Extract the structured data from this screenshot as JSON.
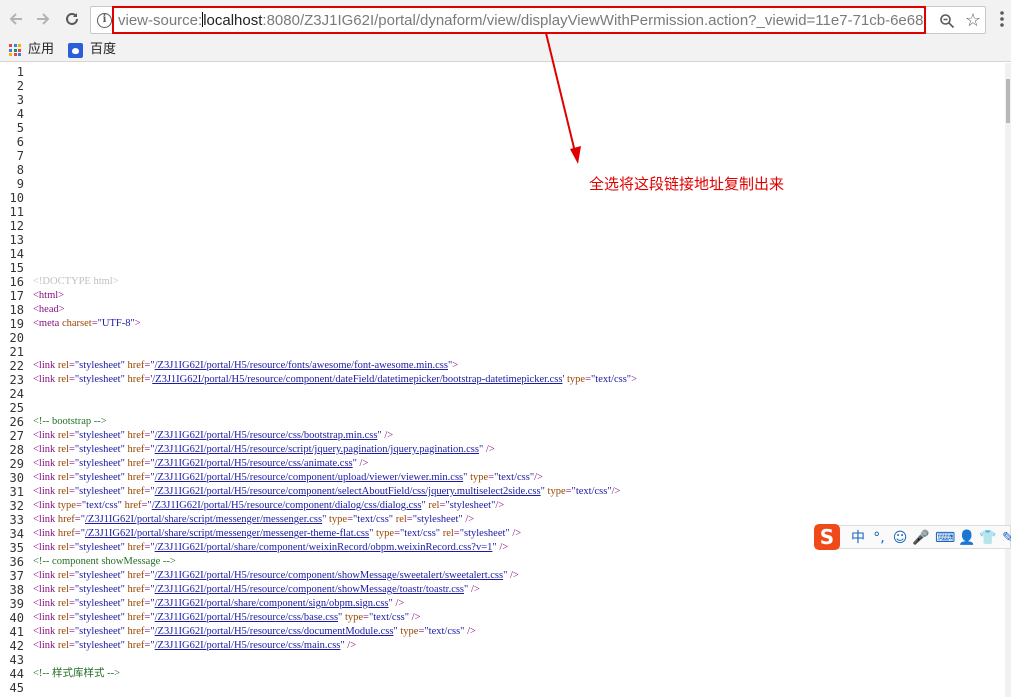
{
  "toolbar": {
    "url_prefix": "view-source:",
    "url_host": "localhost",
    "url_rest": ":8080/Z3J1IG62I/portal/dynaform/view/displayViewWithPermission.action?_viewid=11e7-71cb-6e68"
  },
  "bookmarks": [
    {
      "label": "应用",
      "icon": "apps-grid-icon"
    },
    {
      "label": "百度",
      "icon": "baidu-paw-icon"
    }
  ],
  "annotation": {
    "text": "全选将这段链接地址复制出来",
    "color": "#e00000"
  },
  "source_lines": [
    {
      "n": "1",
      "html": ""
    },
    {
      "n": "2",
      "html": ""
    },
    {
      "n": "3",
      "html": ""
    },
    {
      "n": "4",
      "html": ""
    },
    {
      "n": "5",
      "html": ""
    },
    {
      "n": "6",
      "html": ""
    },
    {
      "n": "7",
      "html": ""
    },
    {
      "n": "8",
      "html": ""
    },
    {
      "n": "9",
      "html": ""
    },
    {
      "n": "10",
      "html": ""
    },
    {
      "n": "11",
      "html": ""
    },
    {
      "n": "12",
      "html": ""
    },
    {
      "n": "13",
      "html": ""
    },
    {
      "n": "14",
      "html": ""
    },
    {
      "n": "15",
      "html": ""
    },
    {
      "n": "16",
      "html": "<span class=\"doc\">&lt;!DOCTYPE html&gt;</span>"
    },
    {
      "n": "17",
      "html": "<span class=\"tag\">&lt;html&gt;</span>"
    },
    {
      "n": "18",
      "html": "<span class=\"tag\">&lt;head&gt;</span>"
    },
    {
      "n": "19",
      "html": "<span class=\"tag\">&lt;meta </span><span class=\"attr\">charset</span><span class=\"tag\">=</span><span class=\"val\">\"UTF-8\"</span><span class=\"tag\">&gt;</span>"
    },
    {
      "n": "20",
      "html": ""
    },
    {
      "n": "21",
      "html": ""
    },
    {
      "n": "22",
      "html": "<span class=\"tag\">&lt;link </span><span class=\"attr\">rel</span><span class=\"tag\">=</span><span class=\"val\">\"stylesheet\"</span> <span class=\"attr\">href</span><span class=\"tag\">=</span><span class=\"val\">\"</span><span class=\"link\">/Z3J1IG62I/portal/H5/resource/fonts/awesome/font-awesome.min.css</span><span class=\"val\">\"</span><span class=\"tag\">&gt;</span>"
    },
    {
      "n": "23",
      "html": "<span class=\"tag\">&lt;link </span><span class=\"attr\">rel</span><span class=\"tag\">=</span><span class=\"val\">\"stylesheet\"</span> <span class=\"attr\">href</span><span class=\"tag\">=</span><span class=\"val\">'</span><span class=\"link\">/Z3J1IG62I/portal/H5/resource/component/dateField/datetimepicker/bootstrap-datetimepicker.css</span><span class=\"val\">'</span> <span class=\"attr\">type</span><span class=\"tag\">=</span><span class=\"val\">\"text/css\"</span><span class=\"tag\">&gt;</span>"
    },
    {
      "n": "24",
      "html": ""
    },
    {
      "n": "25",
      "html": ""
    },
    {
      "n": "26",
      "html": "<span class=\"cmt\">&lt;!-- bootstrap --&gt;</span>"
    },
    {
      "n": "27",
      "html": "<span class=\"tag\">&lt;link </span><span class=\"attr\">rel</span><span class=\"tag\">=</span><span class=\"val\">\"stylesheet\"</span> <span class=\"attr\">href</span><span class=\"tag\">=</span><span class=\"val\">\"</span><span class=\"link\">/Z3J1IG62I/portal/H5/resource/css/bootstrap.min.css</span><span class=\"val\">\"</span><span class=\"tag\"> /&gt;</span>"
    },
    {
      "n": "28",
      "html": "<span class=\"tag\">&lt;link </span><span class=\"attr\">rel</span><span class=\"tag\">=</span><span class=\"val\">\"stylesheet\"</span> <span class=\"attr\">href</span><span class=\"tag\">=</span><span class=\"val\">\"</span><span class=\"link\">/Z3J1IG62I/portal/H5/resource/script/jquery.pagination/jquery.pagination.css</span><span class=\"val\">\"</span><span class=\"tag\"> /&gt;</span>"
    },
    {
      "n": "29",
      "html": "<span class=\"tag\">&lt;link </span><span class=\"attr\">rel</span><span class=\"tag\">=</span><span class=\"val\">\"stylesheet\"</span> <span class=\"attr\">href</span><span class=\"tag\">=</span><span class=\"val\">\"</span><span class=\"link\">/Z3J1IG62I/portal/H5/resource/css/animate.css</span><span class=\"val\">\"</span><span class=\"tag\"> /&gt;</span>"
    },
    {
      "n": "30",
      "html": "<span class=\"tag\">&lt;link </span><span class=\"attr\">rel</span><span class=\"tag\">=</span><span class=\"val\">\"stylesheet\"</span> <span class=\"attr\">href</span><span class=\"tag\">=</span><span class=\"val\">\"</span><span class=\"link\">/Z3J1IG62I/portal/H5/resource/component/upload/viewer/viewer.min.css</span><span class=\"val\">\"</span> <span class=\"attr\">type</span><span class=\"tag\">=</span><span class=\"val\">\"text/css\"</span><span class=\"tag\">/&gt;</span>"
    },
    {
      "n": "31",
      "html": "<span class=\"tag\">&lt;link </span><span class=\"attr\">rel</span><span class=\"tag\">=</span><span class=\"val\">\"stylesheet\"</span> <span class=\"attr\">href</span><span class=\"tag\">=</span><span class=\"val\">\"</span><span class=\"link\">/Z3J1IG62I/portal/H5/resource/component/selectAboutField/css/jquery.multiselect2side.css</span><span class=\"val\">\"</span> <span class=\"attr\">type</span><span class=\"tag\">=</span><span class=\"val\">\"text/css\"</span><span class=\"tag\">/&gt;</span>"
    },
    {
      "n": "32",
      "html": "<span class=\"tag\">&lt;link </span><span class=\"attr\">type</span><span class=\"tag\">=</span><span class=\"val\">\"text/css\"</span> <span class=\"attr\">href</span><span class=\"tag\">=</span><span class=\"val\">\"</span><span class=\"link\">/Z3J1IG62I/portal/H5/resource/component/dialog/css/dialog.css</span><span class=\"val\">\"</span> <span class=\"attr\">rel</span><span class=\"tag\">=</span><span class=\"val\">\"stylesheet\"</span><span class=\"tag\">/&gt;</span>"
    },
    {
      "n": "33",
      "html": "<span class=\"tag\">&lt;link </span><span class=\"attr\">href</span><span class=\"tag\">=</span><span class=\"val\">\"</span><span class=\"link\">/Z3J1IG62I/portal/share/script/messenger/messenger.css</span><span class=\"val\">\"</span> <span class=\"attr\">type</span><span class=\"tag\">=</span><span class=\"val\">\"text/css\"</span> <span class=\"attr\">rel</span><span class=\"tag\">=</span><span class=\"val\">\"stylesheet\"</span><span class=\"tag\"> /&gt;</span>"
    },
    {
      "n": "34",
      "html": "<span class=\"tag\">&lt;link </span><span class=\"attr\">href</span><span class=\"tag\">=</span><span class=\"val\">\"</span><span class=\"link\">/Z3J1IG62I/portal/share/script/messenger/messenger-theme-flat.css</span><span class=\"val\">\"</span> <span class=\"attr\">type</span><span class=\"tag\">=</span><span class=\"val\">\"text/css\"</span> <span class=\"attr\">rel</span><span class=\"tag\">=</span><span class=\"val\">\"stylesheet\"</span><span class=\"tag\"> /&gt;</span>"
    },
    {
      "n": "35",
      "html": "<span class=\"tag\">&lt;link </span><span class=\"attr\">rel</span><span class=\"tag\">=</span><span class=\"val\">\"stylesheet\"</span> <span class=\"attr\">href</span><span class=\"tag\">=</span><span class=\"val\">\"</span><span class=\"link\">/Z3J1IG62I/portal/share/component/weixinRecord/obpm.weixinRecord.css?v=1</span><span class=\"val\">\"</span><span class=\"tag\"> /&gt;</span>"
    },
    {
      "n": "36",
      "html": "<span class=\"cmt\">&lt;!-- component showMessage --&gt;</span>"
    },
    {
      "n": "37",
      "html": "<span class=\"tag\">&lt;link </span><span class=\"attr\">rel</span><span class=\"tag\">=</span><span class=\"val\">\"stylesheet\"</span> <span class=\"attr\">href</span><span class=\"tag\">=</span><span class=\"val\">\"</span><span class=\"link\">/Z3J1IG62I/portal/H5/resource/component/showMessage/sweetalert/sweetalert.css</span><span class=\"val\">\"</span><span class=\"tag\"> /&gt;</span>"
    },
    {
      "n": "38",
      "html": "<span class=\"tag\">&lt;link </span><span class=\"attr\">rel</span><span class=\"tag\">=</span><span class=\"val\">\"stylesheet\"</span> <span class=\"attr\">href</span><span class=\"tag\">=</span><span class=\"val\">\"</span><span class=\"link\">/Z3J1IG62I/portal/H5/resource/component/showMessage/toastr/toastr.css</span><span class=\"val\">\"</span><span class=\"tag\"> /&gt;</span>"
    },
    {
      "n": "39",
      "html": "<span class=\"tag\">&lt;link </span><span class=\"attr\">rel</span><span class=\"tag\">=</span><span class=\"val\">\"stylesheet\"</span> <span class=\"attr\">href</span><span class=\"tag\">=</span><span class=\"val\">\"</span><span class=\"link\">/Z3J1IG62I/portal/share/component/sign/obpm.sign.css</span><span class=\"val\">\"</span><span class=\"tag\"> /&gt;</span>"
    },
    {
      "n": "40",
      "html": "<span class=\"tag\">&lt;link </span><span class=\"attr\">rel</span><span class=\"tag\">=</span><span class=\"val\">\"stylesheet\"</span> <span class=\"attr\">href</span><span class=\"tag\">=</span><span class=\"val\">\"</span><span class=\"link\">/Z3J1IG62I/portal/H5/resource/css/base.css</span><span class=\"val\">\"</span> <span class=\"attr\">type</span><span class=\"tag\">=</span><span class=\"val\">\"text/css\"</span><span class=\"tag\"> /&gt;</span>"
    },
    {
      "n": "41",
      "html": "<span class=\"tag\">&lt;link </span><span class=\"attr\">rel</span><span class=\"tag\">=</span><span class=\"val\">\"stylesheet\"</span> <span class=\"attr\">href</span><span class=\"tag\">=</span><span class=\"val\">\"</span><span class=\"link\">/Z3J1IG62I/portal/H5/resource/css/documentModule.css</span><span class=\"val\">\"</span> <span class=\"attr\">type</span><span class=\"tag\">=</span><span class=\"val\">\"text/css\"</span><span class=\"tag\"> /&gt;</span>"
    },
    {
      "n": "42",
      "html": "<span class=\"tag\">&lt;link </span><span class=\"attr\">rel</span><span class=\"tag\">=</span><span class=\"val\">\"stylesheet\"</span> <span class=\"attr\">href</span><span class=\"tag\">=</span><span class=\"val\">\"</span><span class=\"link\">/Z3J1IG62I/portal/H5/resource/css/main.css</span><span class=\"val\">\"</span><span class=\"tag\"> /&gt;</span>"
    },
    {
      "n": "43",
      "html": ""
    },
    {
      "n": "44",
      "html": "<span class=\"cmt\">&lt;!-- 样式库样式 --&gt;</span>"
    },
    {
      "n": "45",
      "html": ""
    }
  ],
  "ime_toolbar": {
    "logo": "S",
    "items": [
      {
        "name": "ime-chinese-mode",
        "label": "中"
      },
      {
        "name": "ime-punctuation",
        "label": "°,"
      },
      {
        "name": "ime-emoji",
        "label": "☺"
      },
      {
        "name": "ime-voice",
        "label": "🎤"
      },
      {
        "name": "ime-keyboard",
        "label": "⌨"
      },
      {
        "name": "ime-user",
        "label": "👤"
      },
      {
        "name": "ime-skin",
        "label": "👕"
      },
      {
        "name": "ime-tools",
        "label": "✎"
      }
    ]
  },
  "colors": {
    "tag": "#881280",
    "attribute": "#994500",
    "value": "#1a1aa6",
    "comment": "#236e25",
    "annotation": "#e00000",
    "ime_logo": "#f04a1b"
  }
}
